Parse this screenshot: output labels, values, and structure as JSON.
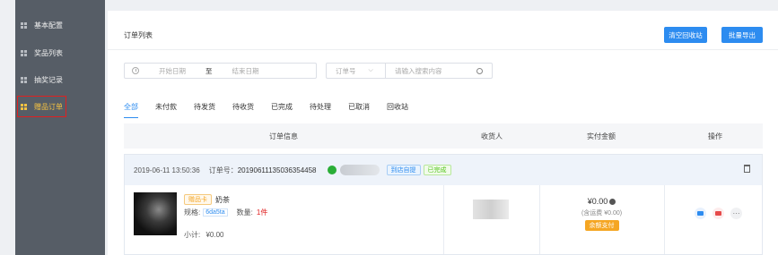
{
  "sidebar": {
    "items": [
      {
        "label": "基本配置",
        "active": false
      },
      {
        "label": "奖品列表",
        "active": false
      },
      {
        "label": "抽奖记录",
        "active": false
      },
      {
        "label": "赠品订单",
        "active": true
      }
    ]
  },
  "header": {
    "title": "订单列表",
    "recycle_label": "清空回收站",
    "export_label": "批量导出"
  },
  "filters": {
    "start_date_placeholder": "开始日期",
    "date_separator": "至",
    "end_date_placeholder": "结束日期",
    "search_field_label": "订单号",
    "search_placeholder": "请输入搜索内容"
  },
  "tabs": [
    "全部",
    "未付款",
    "待发货",
    "待收货",
    "已完成",
    "待处理",
    "已取消",
    "回收站"
  ],
  "table": {
    "headers": [
      "订单信息",
      "收货人",
      "实付金额",
      "操作"
    ]
  },
  "order": {
    "time": "2019-06-11 13:50:36",
    "order_no_label": "订单号：",
    "order_no": "20190611135036354458",
    "tag_pickup": "到店自提",
    "tag_status": "已完成",
    "product": {
      "type_tag": "赠品卡",
      "name": "奶茶",
      "spec_label": "规格:",
      "spec_value": "6da5ta",
      "qty_label": "数量:",
      "qty_value": "1件",
      "subtotal_label": "小计:",
      "subtotal_value": "¥0.00"
    },
    "amount": "¥0.00",
    "amount_note": "(含运费 ¥0.00)",
    "pay_tag": "余额支付"
  },
  "colors": {
    "sidebar_bg": "#565d66",
    "accent": "#2d8cf0",
    "active_menu": "#f5c242",
    "highlight_border": "#e02020",
    "wechat": "#2aae37",
    "pay_tag": "#f5a623"
  }
}
